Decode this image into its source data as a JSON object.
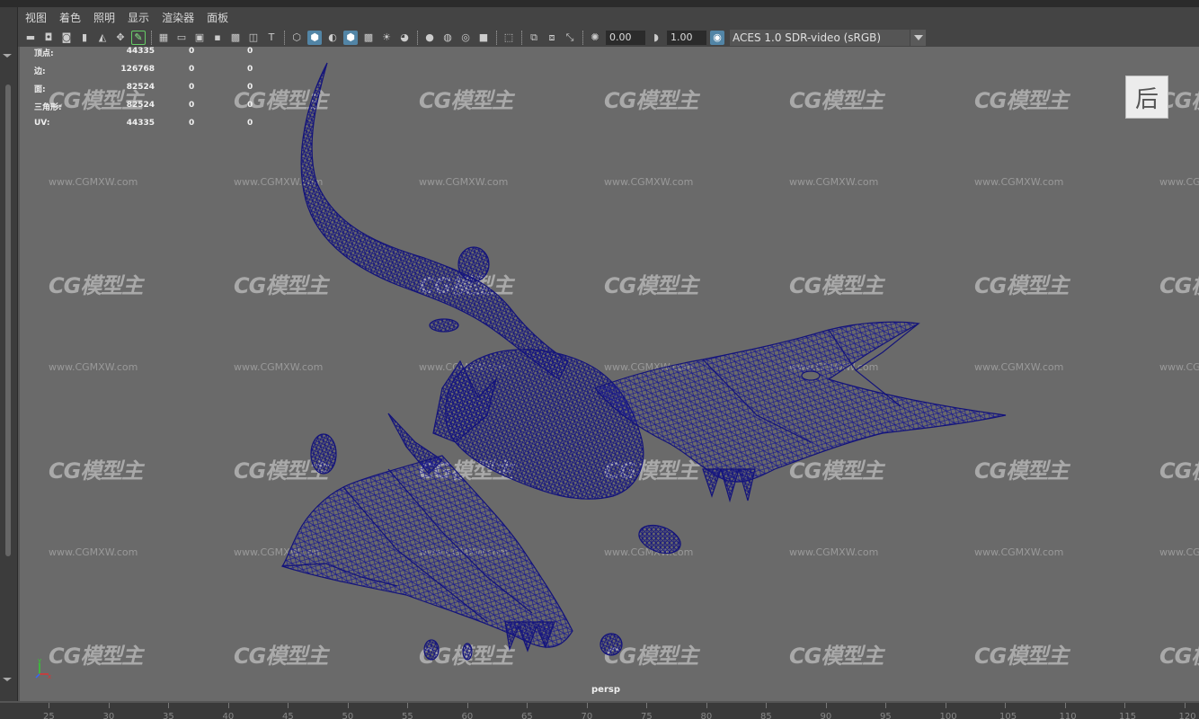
{
  "menu": [
    "视图",
    "着色",
    "照明",
    "显示",
    "渲染器",
    "面板"
  ],
  "toolbar": {
    "field_exposure": "0.00",
    "field_gamma": "1.00",
    "colorspace": "ACES 1.0 SDR-video (sRGB)",
    "icons": [
      "camera-select-icon",
      "camera-attr-icon",
      "bookmark-icon",
      "image-plane-icon",
      "2d-pan-icon",
      "grease-pencil-icon",
      "grid-icon",
      "film-gate-icon",
      "resolution-gate-icon",
      "gate-mask-icon",
      "field-chart-icon",
      "safe-action-icon",
      "safe-title-icon",
      "wireframe-icon",
      "smooth-shade-icon",
      "wireframe-on-shaded-icon",
      "xray-icon",
      "use-default-material-icon",
      "all-lights-icon",
      "shadows-icon",
      "ambient-occlusion-icon",
      "motion-blur-icon",
      "antialias-icon",
      "depth-of-field-icon",
      "isolate-select-icon",
      "xray-joints-icon",
      "xray-active-icon",
      "backface-icon",
      "exposure-icon",
      "gamma-icon",
      "color-management-icon"
    ]
  },
  "hud": {
    "rows": [
      {
        "label": "顶点:",
        "v1": "44335",
        "v2": "0",
        "v3": "0"
      },
      {
        "label": "边:",
        "v1": "126768",
        "v2": "0",
        "v3": "0"
      },
      {
        "label": "面:",
        "v1": "82524",
        "v2": "0",
        "v3": "0"
      },
      {
        "label": "三角形:",
        "v1": "82524",
        "v2": "0",
        "v3": "0"
      },
      {
        "label": "UV:",
        "v1": "44335",
        "v2": "0",
        "v3": "0"
      }
    ]
  },
  "viewport": {
    "camera": "persp",
    "badge": "后",
    "watermark": "CG模型主",
    "watermark_url": "www.CGMXW.com",
    "model_color": "#1a1a8c",
    "background": "#6a6a6a"
  },
  "axis": {
    "x": "x",
    "y": "y",
    "z": "z"
  },
  "timeline": {
    "ticks": [
      "25",
      "30",
      "35",
      "40",
      "45",
      "50",
      "55",
      "60",
      "65",
      "70",
      "75",
      "80",
      "85",
      "90",
      "95",
      "100",
      "105",
      "110",
      "115",
      "120"
    ]
  }
}
